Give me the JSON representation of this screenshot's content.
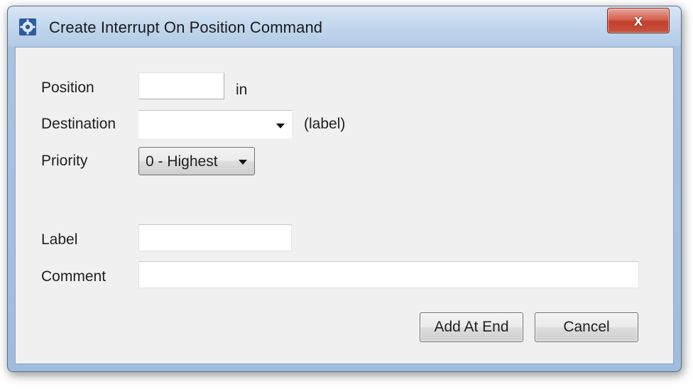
{
  "window": {
    "title": "Create Interrupt On Position Command",
    "app_icon": "gear-icon",
    "close_icon": "close-icon",
    "close_glyph": "x"
  },
  "form": {
    "position": {
      "label": "Position",
      "value": "",
      "unit": "in"
    },
    "destination": {
      "label": "Destination",
      "value": "",
      "hint": "(label)"
    },
    "priority": {
      "label": "Priority",
      "value": "0 - Highest"
    },
    "label_field": {
      "label": "Label",
      "value": ""
    },
    "comment": {
      "label": "Comment",
      "value": ""
    }
  },
  "buttons": {
    "add_at_end": "Add At End",
    "cancel": "Cancel"
  }
}
